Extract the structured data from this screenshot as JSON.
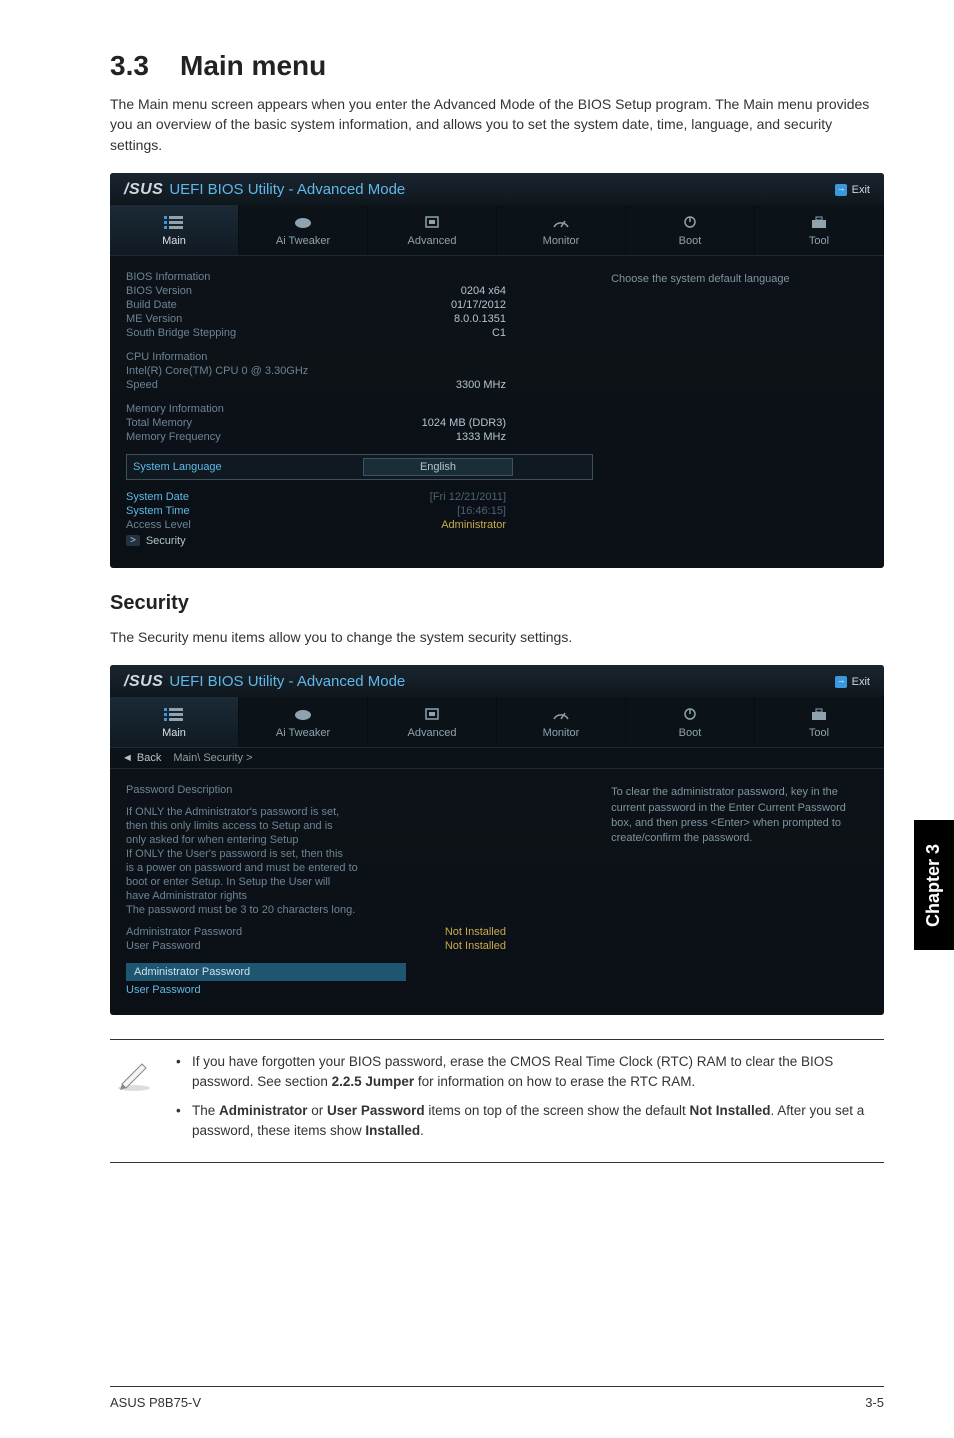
{
  "section": {
    "number": "3.3",
    "title": "Main menu",
    "intro": "The Main menu screen appears when you enter the Advanced Mode of the BIOS Setup program. The Main menu provides you an overview of the basic system information, and allows you to set the system date, time, language, and security settings."
  },
  "bios1": {
    "logo": "/SUS",
    "utility_text": "UEFI BIOS Utility - Advanced Mode",
    "exit_label": "Exit",
    "tabs": [
      "Main",
      "Ai Tweaker",
      "Advanced",
      "Monitor",
      "Boot",
      "Tool"
    ],
    "help_text": "Choose the system default language",
    "groups": {
      "bios_info_header": "BIOS Information",
      "bios_version_label": "BIOS Version",
      "bios_version_value": "0204 x64",
      "build_date_label": "Build Date",
      "build_date_value": "01/17/2012",
      "me_version_label": "ME Version",
      "me_version_value": "8.0.0.1351",
      "sb_step_label": "South Bridge Stepping",
      "sb_step_value": "C1",
      "cpu_info_header": "CPU Information",
      "cpu_model": "Intel(R) Core(TM) CPU 0 @ 3.30GHz",
      "speed_label": "Speed",
      "speed_value": "3300 MHz",
      "mem_info_header": "Memory Information",
      "total_mem_label": "Total Memory",
      "total_mem_value": "1024 MB (DDR3)",
      "mem_freq_label": "Memory Frequency",
      "mem_freq_value": "1333 MHz",
      "sys_lang_label": "System Language",
      "sys_lang_value": "English",
      "sys_date_label": "System Date",
      "sys_date_value": "[Fri 12/21/2011]",
      "sys_time_label": "System Time",
      "sys_time_value": "[16:46:15]",
      "access_label": "Access Level",
      "access_value": "Administrator",
      "security_item": "Security"
    }
  },
  "security": {
    "heading": "Security",
    "intro": "The Security menu items allow you to change the system security settings."
  },
  "bios2": {
    "back_label": "Back",
    "breadcrumb": "Main\\ Security >",
    "help_text": "To clear the administrator password, key in the current password in the Enter Current Password box, and then press <Enter> when prompted to create/confirm the password.",
    "pwd_desc_header": "Password Description",
    "desc_line1": "If ONLY the Administrator's password is set,",
    "desc_line2": "then this only limits access to Setup and is",
    "desc_line3": "only asked for when entering Setup",
    "desc_line4": "If ONLY the User's password is set, then this",
    "desc_line5": "is a power on password and must be entered to",
    "desc_line6": "boot or enter Setup. In Setup the User will",
    "desc_line7": "have Administrator rights",
    "desc_line8": "The password must be 3 to 20 characters long.",
    "admin_pwd_label": "Administrator Password",
    "admin_pwd_value": "Not Installed",
    "user_pwd_label": "User Password",
    "user_pwd_value": "Not Installed",
    "admin_pwd_item": "Administrator Password",
    "user_pwd_item": "User Password"
  },
  "chapter_tab": "Chapter 3",
  "note": {
    "bullet1_a": "If you have forgotten your BIOS password, erase the CMOS Real Time Clock (RTC) RAM to clear the BIOS password. See section ",
    "bullet1_b": "2.2.5 Jumper",
    "bullet1_c": " for information on how to erase the RTC RAM.",
    "bullet2_a": "The ",
    "bullet2_b": "Administrator",
    "bullet2_c": " or ",
    "bullet2_d": "User Password",
    "bullet2_e": " items on top of the screen show the default ",
    "bullet2_f": "Not Installed",
    "bullet2_g": ". After you set a password, these items show ",
    "bullet2_h": "Installed",
    "bullet2_i": "."
  },
  "footer": {
    "left": "ASUS P8B75-V",
    "right": "3-5"
  }
}
